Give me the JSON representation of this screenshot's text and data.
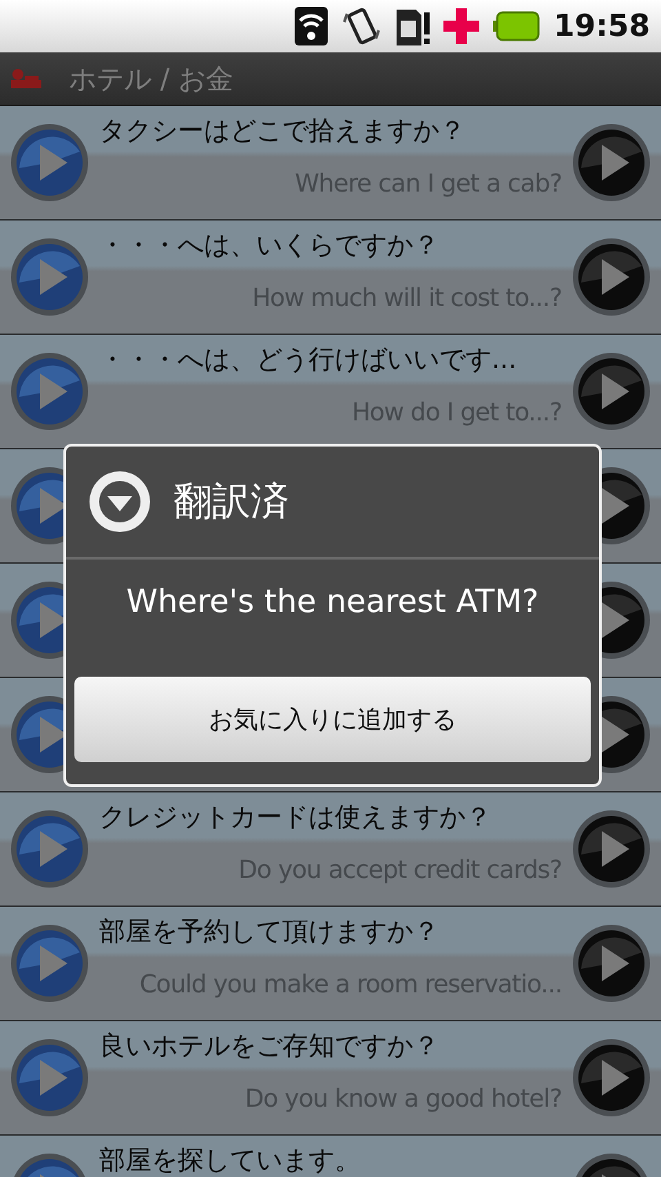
{
  "status_bar": {
    "time": "19:58"
  },
  "title_bar": {
    "title": "ホテル / お金"
  },
  "phrases": [
    {
      "kind": "phrase",
      "japanese": "タクシーはどこで拾えますか？",
      "english": "Where can I get a cab?"
    },
    {
      "kind": "phrase",
      "japanese": "・・・へは、いくらですか？",
      "english": "How much will it cost to...?"
    },
    {
      "kind": "phrase",
      "japanese": "・・・へは、どう行けばいいです...",
      "english": "How do I get to...?"
    },
    {
      "kind": "covered"
    },
    {
      "kind": "covered"
    },
    {
      "kind": "covered"
    },
    {
      "kind": "phrase",
      "japanese": "クレジットカードは使えますか？",
      "english": "Do you accept credit cards?"
    },
    {
      "kind": "phrase",
      "japanese": "部屋を予約して頂けますか？",
      "english": "Could you make a room reservatio..."
    },
    {
      "kind": "phrase",
      "japanese": "良いホテルをご存知ですか？",
      "english": "Do you know a good hotel?"
    },
    {
      "kind": "phrase",
      "japanese": "部屋を探しています。"
    }
  ],
  "dialog": {
    "title": "翻訳済",
    "message": "Where's the nearest ATM?",
    "button": "お気に入りに追加する"
  }
}
